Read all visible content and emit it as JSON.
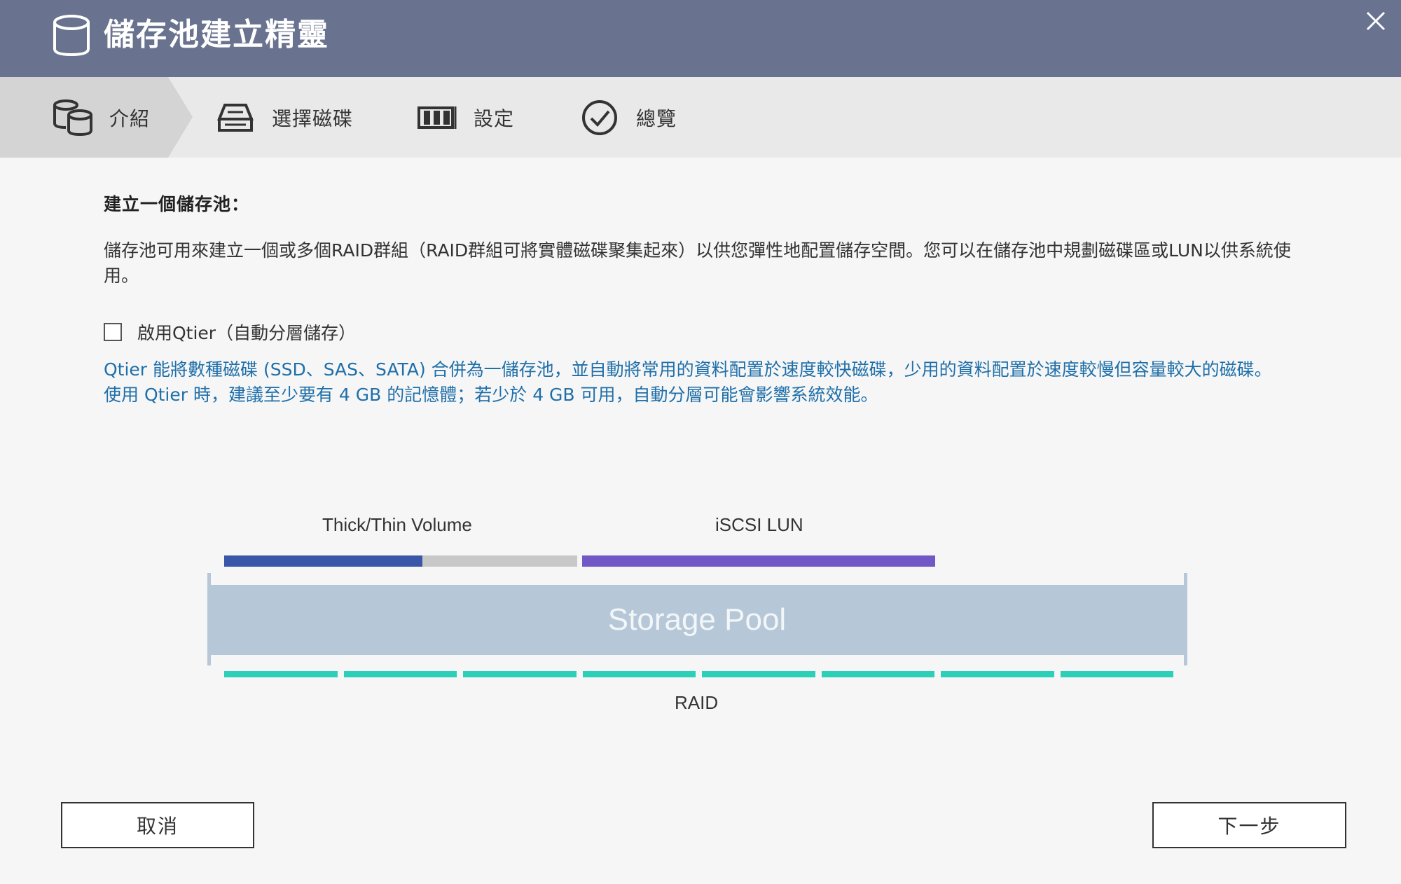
{
  "window": {
    "title": "儲存池建立精靈",
    "icon": "storage-cylinder-icon",
    "close_icon": "close-icon"
  },
  "steps": [
    {
      "label": "介紹",
      "icon": "introduction-icon",
      "active": true
    },
    {
      "label": "選擇磁碟",
      "icon": "disk-drive-icon",
      "active": false
    },
    {
      "label": "設定",
      "icon": "settings-bars-icon",
      "active": false
    },
    {
      "label": "總覽",
      "icon": "checkmark-circle-icon",
      "active": false
    }
  ],
  "content": {
    "heading": "建立一個儲存池：",
    "description": "儲存池可用來建立一個或多個RAID群組（RAID群組可將實體磁碟聚集起來）以供您彈性地配置儲存空間。您可以在儲存池中規劃磁碟區或LUN以供系統使用。",
    "qtier_checkbox_label": "啟用Qtier（自動分層儲存）",
    "qtier_checked": false,
    "qtier_info_1": "Qtier 能將數種磁碟 (SSD、SAS、SATA) 合併為一儲存池，並自動將常用的資料配置於速度較快磁碟，少用的資料配置於速度較慢但容量較大的磁碟。",
    "qtier_info_2": "使用 Qtier 時，建議至少要有 4 GB 的記憶體；若少於 4 GB 可用，自動分層可能會影響系統效能。"
  },
  "diagram": {
    "volume_label": "Thick/Thin Volume",
    "lun_label": "iSCSI LUN",
    "pool_label": "Storage Pool",
    "raid_label": "RAID",
    "raid_segments": 8,
    "colors": {
      "volume_used": "#3a56a8",
      "volume_free": "#c8c8c8",
      "lun": "#7158c4",
      "pool": "#b6c8d8",
      "raid": "#2ccfb8",
      "info_text": "#1f6fa9",
      "titlebar": "#69728f"
    }
  },
  "buttons": {
    "cancel": "取消",
    "next": "下一步"
  }
}
